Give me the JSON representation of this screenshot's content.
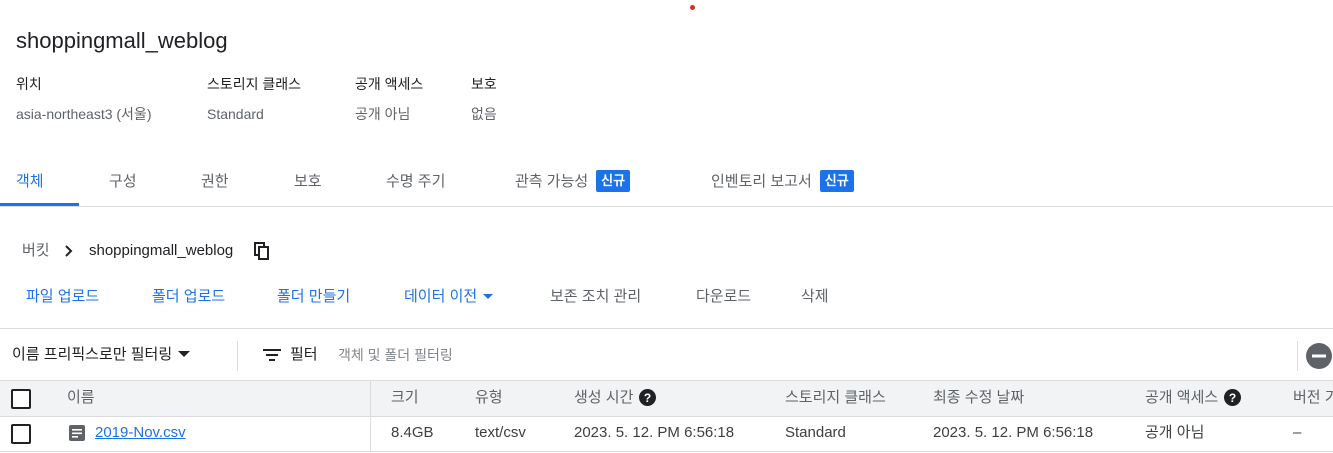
{
  "bucket": {
    "name": "shoppingmall_weblog",
    "meta": [
      {
        "key": "위치",
        "value": "asia-northeast3 (서울)"
      },
      {
        "key": "스토리지 클래스",
        "value": "Standard"
      },
      {
        "key": "공개 액세스",
        "value": "공개 아님"
      },
      {
        "key": "보호",
        "value": "없음"
      }
    ]
  },
  "tabs": [
    {
      "label": "객체",
      "active": true
    },
    {
      "label": "구성"
    },
    {
      "label": "권한"
    },
    {
      "label": "보호"
    },
    {
      "label": "수명 주기"
    },
    {
      "label": "관측 가능성",
      "badge": "신규"
    },
    {
      "label": "인벤토리 보고서",
      "badge": "신규"
    }
  ],
  "breadcrumb": {
    "root": "버킷",
    "current": "shoppingmall_weblog"
  },
  "actions": {
    "upload_file": "파일 업로드",
    "upload_folder": "폴더 업로드",
    "create_folder": "폴더 만들기",
    "transfer_data": "데이터 이전",
    "retention": "보존 조치 관리",
    "download": "다운로드",
    "delete": "삭제"
  },
  "filterbar": {
    "prefix_filter": "이름 프리픽스로만 필터링",
    "filter_label": "필터",
    "placeholder": "객체 및 폴더 필터링"
  },
  "table": {
    "headers": {
      "name": "이름",
      "size": "크기",
      "type": "유형",
      "created": "생성 시간",
      "storage_class": "스토리지 클래스",
      "modified": "최종 수정 날짜",
      "public_access": "공개 액세스",
      "version": "버전 기"
    },
    "rows": [
      {
        "name": "2019-Nov.csv",
        "size": "8.4GB",
        "type": "text/csv",
        "created": "2023. 5. 12. PM 6:56:18",
        "storage_class": "Standard",
        "modified": "2023. 5. 12. PM 6:56:18",
        "public_access": "공개 아님",
        "version": "–"
      }
    ]
  },
  "colors": {
    "accent": "#1a73e8",
    "text": "#202124",
    "muted": "#5f6368",
    "border": "#dadce0",
    "header_bg": "#f1f3f4"
  }
}
